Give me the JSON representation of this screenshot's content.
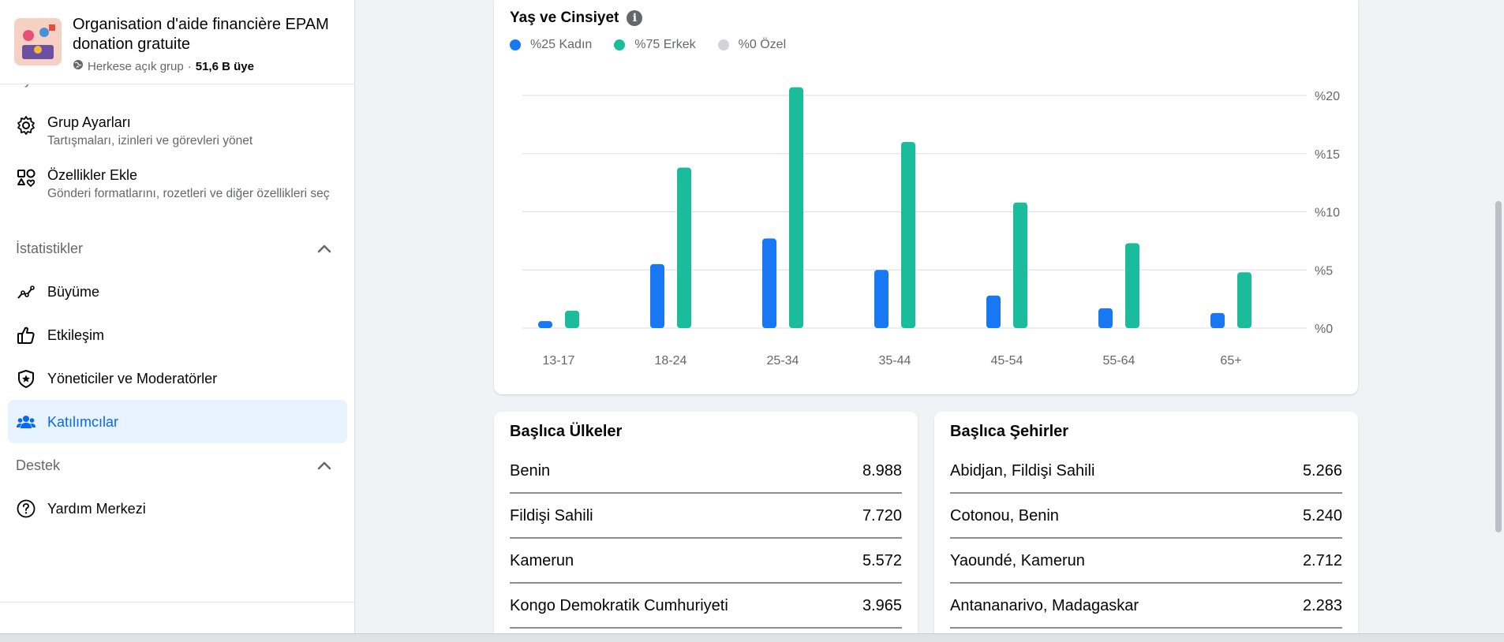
{
  "group": {
    "name": "Organisation d'aide financière EPAM donation gratuite",
    "privacy": "Herkese açık grup",
    "separator": "·",
    "members": "51,6 B üye"
  },
  "sidebar": {
    "cut_off_label": "Ayarlar",
    "settings_items": [
      {
        "title": "Grup Ayarları",
        "subtitle": "Tartışmaları, izinleri ve görevleri yönet",
        "icon": "gear-icon"
      },
      {
        "title": "Özellikler Ekle",
        "subtitle": "Gönderi formatlarını, rozetleri ve diğer özellikleri seç",
        "icon": "shapes-icon"
      }
    ],
    "stats_section": "İstatistikler",
    "stats_items": [
      {
        "title": "Büyüme",
        "icon": "trend-line-icon"
      },
      {
        "title": "Etkileşim",
        "icon": "thumbs-up-icon"
      },
      {
        "title": "Yöneticiler ve Moderatörler",
        "icon": "shield-star-icon"
      },
      {
        "title": "Katılımcılar",
        "icon": "people-icon",
        "active": true
      }
    ],
    "support_section": "Destek",
    "support_items": [
      {
        "title": "Yardım Merkezi",
        "icon": "question-circle-icon"
      }
    ]
  },
  "age_gender": {
    "title": "Yaş ve Cinsiyet",
    "legend": [
      {
        "label": "%25 Kadın",
        "color": "#1877f2"
      },
      {
        "label": "%75 Erkek",
        "color": "#1abc9c"
      },
      {
        "label": "%0 Özel",
        "color": "#d0d3d7"
      }
    ]
  },
  "chart_data": {
    "type": "bar",
    "categories": [
      "13-17",
      "18-24",
      "25-34",
      "35-44",
      "45-54",
      "55-64",
      "65+"
    ],
    "series": [
      {
        "name": "Kadın",
        "color": "#1877f2",
        "values": [
          0.6,
          5.5,
          7.7,
          5.0,
          2.8,
          1.7,
          1.3
        ]
      },
      {
        "name": "Erkek",
        "color": "#1abc9c",
        "values": [
          1.5,
          13.8,
          20.7,
          16.0,
          10.8,
          7.3,
          4.8
        ]
      }
    ],
    "yticks": [
      "%0",
      "%5",
      "%10",
      "%15",
      "%20"
    ],
    "ylim": [
      0,
      20
    ],
    "grid": true
  },
  "countries": {
    "title": "Başlıca Ülkeler",
    "rows": [
      {
        "name": "Benin",
        "value": "8.988"
      },
      {
        "name": "Fildişi Sahili",
        "value": "7.720"
      },
      {
        "name": "Kamerun",
        "value": "5.572"
      },
      {
        "name": "Kongo Demokratik Cumhuriyeti",
        "value": "3.965"
      }
    ]
  },
  "cities": {
    "title": "Başlıca Şehirler",
    "rows": [
      {
        "name": "Abidjan, Fildişi Sahili",
        "value": "5.266"
      },
      {
        "name": "Cotonou, Benin",
        "value": "5.240"
      },
      {
        "name": "Yaoundé, Kamerun",
        "value": "2.712"
      },
      {
        "name": "Antananarivo, Madagaskar",
        "value": "2.283"
      }
    ]
  }
}
